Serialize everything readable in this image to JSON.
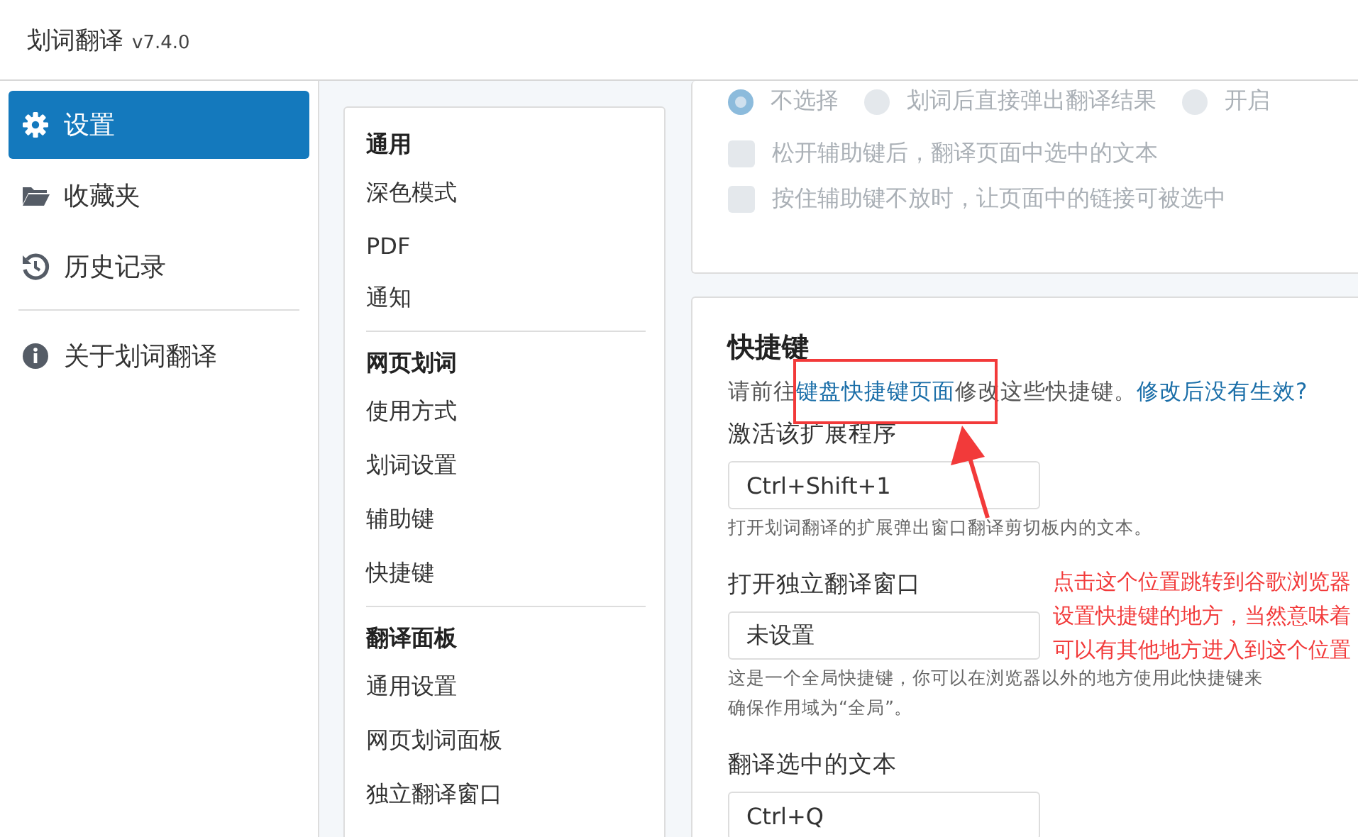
{
  "header": {
    "title": "划词翻译",
    "version": "v7.4.0"
  },
  "sidebar": {
    "items": [
      {
        "kind": "settings",
        "label": "设置",
        "selected": true
      },
      {
        "kind": "favorites",
        "label": "收藏夹",
        "selected": false
      },
      {
        "kind": "history",
        "label": "历史记录",
        "selected": false
      }
    ],
    "footer_items": [
      {
        "kind": "about",
        "label": "关于划词翻译",
        "selected": false
      }
    ]
  },
  "nav": [
    {
      "heading": "通用",
      "items": [
        "深色模式",
        "PDF",
        "通知"
      ]
    },
    {
      "heading": "网页划词",
      "items": [
        "使用方式",
        "划词设置",
        "辅助键",
        "快捷键"
      ]
    },
    {
      "heading": "翻译面板",
      "items": [
        "通用设置",
        "网页划词面板",
        "独立翻译窗口"
      ]
    }
  ],
  "options_card": {
    "disabled": true,
    "radios": [
      {
        "label": "不选择",
        "selected": true
      },
      {
        "label": "划词后直接弹出翻译结果",
        "selected": false
      },
      {
        "label": "开启",
        "selected": false
      }
    ],
    "checkboxes": [
      {
        "label": "松开辅助键后，翻译页面中选中的文本",
        "checked": false
      },
      {
        "label": "按住辅助键不放时，让页面中的链接可被选中",
        "checked": false
      }
    ]
  },
  "shortcuts": {
    "title": "快捷键",
    "intro": {
      "before": "请前往",
      "link": "键盘快捷键页面",
      "after": "修改这些快捷键。",
      "help_link": "修改后没有生效?"
    },
    "fields": [
      {
        "label": "激活该扩展程序",
        "value": "Ctrl+Shift+1",
        "hint": [
          "打开划词翻译的扩展弹出窗口翻译剪切板内的文本。"
        ]
      },
      {
        "label": "打开独立翻译窗口",
        "value": "未设置",
        "hint": [
          "这是一个全局快捷键，你可以在浏览器以外的地方使用此快捷键来",
          "确保作用域为“全局”。"
        ]
      },
      {
        "label": "翻译选中的文本",
        "value": "Ctrl+Q"
      }
    ]
  },
  "annotation": {
    "lines": [
      "点击这个位置跳转到谷歌浏览器",
      "设置快捷键的地方，当然意味着",
      "可以有其他地方进入到这个位置"
    ]
  }
}
